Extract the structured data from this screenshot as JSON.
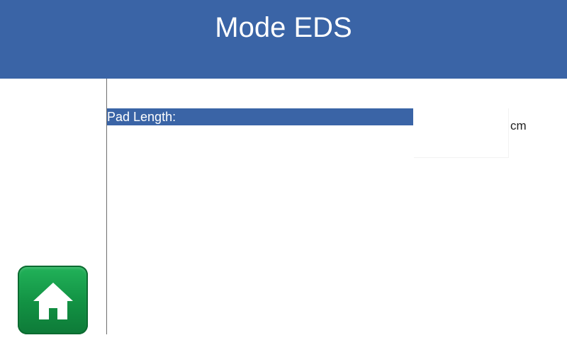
{
  "header": {
    "title": "Mode EDS"
  },
  "field": {
    "label": "Pad Length:",
    "value": "",
    "unit": "cm"
  },
  "home_button": {
    "icon": "home-icon"
  },
  "colors": {
    "header": "#3a64a6",
    "label_bar": "#3a64a6",
    "home_button": "#129143"
  }
}
